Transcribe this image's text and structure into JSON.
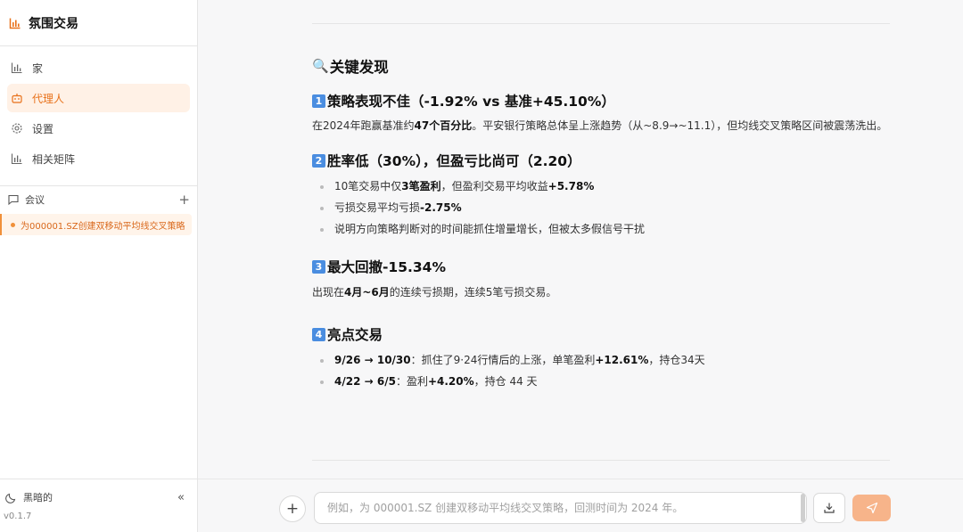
{
  "app": {
    "title": "氛围交易",
    "brand_color": "#e8711a"
  },
  "sidebar": {
    "items": [
      {
        "label": "家",
        "icon": "bar-chart-icon"
      },
      {
        "label": "代理人",
        "icon": "bot-icon",
        "active": true
      },
      {
        "label": "设置",
        "icon": "gear-icon"
      },
      {
        "label": "相关矩阵",
        "icon": "bar-chart-icon"
      }
    ],
    "meetings_label": "会议",
    "meetings": [
      {
        "label": "为000001.SZ创建双移动平均线交叉策略"
      }
    ],
    "theme_label": "黑暗的",
    "version": "v0.1.7"
  },
  "report": {
    "heading": "关键发现",
    "sections": [
      {
        "num": "1",
        "title": "策略表现不佳（-1.92% vs 基准+45.10%）",
        "para": {
          "pre": "在2024年跑赢基准约",
          "bold": "47个百分比",
          "post": "。平安银行策略总体呈上涨趋势（从~8.9→~11.1），但均线交叉策略区间被震荡洗出。"
        }
      },
      {
        "num": "2",
        "title": "胜率低（30%），但盈亏比尚可（2.20）",
        "bullets": [
          {
            "a": "10笔交易中仅",
            "b": "3笔盈利",
            "c": "，但盈利交易平均收益",
            "d": "+5.78%",
            "e": ""
          },
          {
            "a": "亏损交易平均亏损",
            "b": "-2.75%",
            "c": "",
            "d": "",
            "e": ""
          },
          {
            "a": "说明方向策略判断对的时间能抓住增量增长，但被太多假信号干扰",
            "b": "",
            "c": "",
            "d": "",
            "e": ""
          }
        ]
      },
      {
        "num": "3",
        "title": "最大回撤-15.34%",
        "para": {
          "pre": "出现在",
          "bold": "4月~6月",
          "post": "的连续亏损期，连续5笔亏损交易。"
        }
      },
      {
        "num": "4",
        "title": "亮点交易",
        "bullets": [
          {
            "a": "",
            "b": "9/26 → 10/30",
            "c": "：抓住了9·24行情后的上涨，单笔盈利",
            "d": "+12.61%",
            "e": "，持仓34天"
          },
          {
            "a": "",
            "b": "4/22 → 6/5",
            "c": "：盈利",
            "d": "+4.20%",
            "e": "，持仓 44 天"
          }
        ]
      }
    ]
  },
  "composer": {
    "placeholder": "例如，为 000001.SZ 创建双移动平均线交叉策略，回测时间为 2024 年。",
    "value": ""
  }
}
